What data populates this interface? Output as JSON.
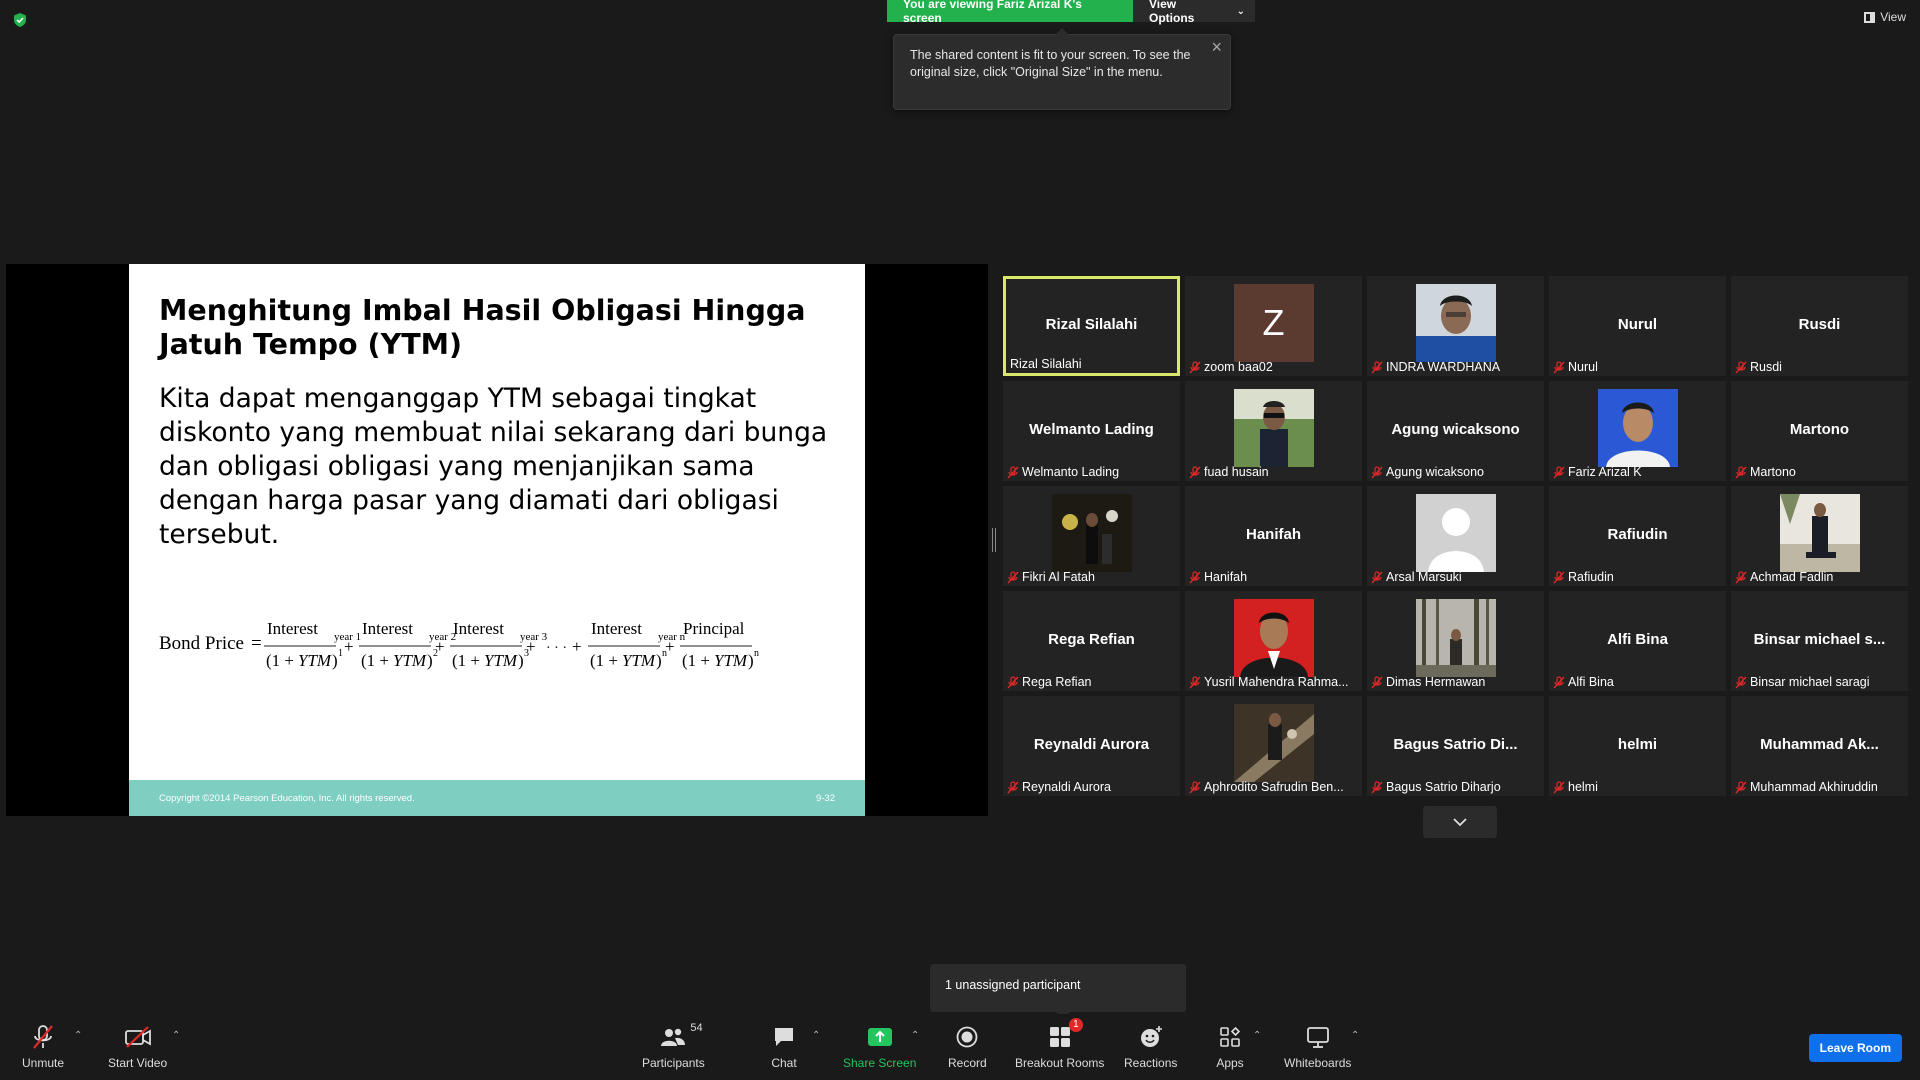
{
  "topbar": {
    "viewing_label": "You are viewing Fariz Arizal K's screen",
    "view_options_label": "View Options",
    "view_label": "View"
  },
  "tooltip": {
    "text": "The shared content is fit to your screen. To see the original size, click \"Original Size\" in the menu."
  },
  "slide": {
    "title": "Menghitung Imbal Hasil Obligasi Hingga Jatuh Tempo (YTM)",
    "body": "Kita dapat menganggap YTM sebagai tingkat diskonto yang membuat nilai sekarang dari bunga dan obligasi obligasi yang menjanjikan sama dengan harga pasar yang diamati dari obligasi tersebut.",
    "formula": {
      "lhs": "Bond Price",
      "terms": [
        {
          "num": "Interest",
          "sub": "year 1",
          "den": "(1 + YTM)",
          "exp": "1"
        },
        {
          "num": "Interest",
          "sub": "year 2",
          "den": "(1 + YTM)",
          "exp": "2"
        },
        {
          "num": "Interest",
          "sub": "year 3",
          "den": "(1 + YTM)",
          "exp": "3"
        },
        {
          "num": "Interest",
          "sub": "year n",
          "den": "(1 + YTM)",
          "exp": "n"
        },
        {
          "num": "Principal",
          "sub": "",
          "den": "(1 + YTM)",
          "exp": "n"
        }
      ],
      "ellipsis": "· · ·"
    },
    "footer_copyright": "Copyright ©2014 Pearson Education, Inc. All rights reserved.",
    "footer_page": "9-32"
  },
  "participants": [
    {
      "name": "Rizal Silalahi",
      "big": "Rizal Silalahi",
      "type": "name",
      "active": true,
      "muted": false
    },
    {
      "name": "zoom baa02",
      "big": "",
      "type": "letter",
      "letter": "Z",
      "muted": true
    },
    {
      "name": "INDRA WARDHANA",
      "big": "",
      "type": "photo",
      "photo": "portrait-blue",
      "muted": true
    },
    {
      "name": "Nurul",
      "big": "Nurul",
      "type": "name",
      "muted": true
    },
    {
      "name": "Rusdi",
      "big": "Rusdi",
      "type": "name",
      "muted": true
    },
    {
      "name": "Welmanto Lading",
      "big": "Welmanto Lading",
      "type": "name",
      "muted": true
    },
    {
      "name": "fuad husain",
      "big": "",
      "type": "photo",
      "photo": "outdoor-green",
      "muted": true
    },
    {
      "name": "Agung wicaksono",
      "big": "Agung wicaksono",
      "type": "name",
      "muted": true
    },
    {
      "name": "Fariz Arizal K",
      "big": "",
      "type": "photo",
      "photo": "portrait-bluebg",
      "muted": true
    },
    {
      "name": "Martono",
      "big": "Martono",
      "type": "name",
      "muted": true
    },
    {
      "name": "Fikri Al Fatah",
      "big": "",
      "type": "photo",
      "photo": "dark-party",
      "muted": true
    },
    {
      "name": "Hanifah",
      "big": "Hanifah",
      "type": "name",
      "muted": true
    },
    {
      "name": "Arsal Marsuki",
      "big": "",
      "type": "photo",
      "photo": "default-silhouette",
      "muted": true
    },
    {
      "name": "Rafiudin",
      "big": "Rafiudin",
      "type": "name",
      "muted": true
    },
    {
      "name": "Achmad Fadlin",
      "big": "",
      "type": "photo",
      "photo": "suit-outdoor",
      "muted": true
    },
    {
      "name": "Rega Refian",
      "big": "Rega Refian",
      "type": "name",
      "muted": true
    },
    {
      "name": "Yusril Mahendra Rahma...",
      "big": "",
      "type": "photo",
      "photo": "portrait-redbg",
      "muted": true
    },
    {
      "name": "Dimas Hermawan",
      "big": "",
      "type": "photo",
      "photo": "forest",
      "muted": true
    },
    {
      "name": "Alfi Bina",
      "big": "Alfi Bina",
      "type": "name",
      "muted": true
    },
    {
      "name": "Binsar michael saragi",
      "big": "Binsar michael s...",
      "type": "name",
      "muted": true
    },
    {
      "name": "Reynaldi Aurora",
      "big": "Reynaldi Aurora",
      "type": "name",
      "muted": true
    },
    {
      "name": "Aphrodito Safrudin Ben...",
      "big": "",
      "type": "photo",
      "photo": "escalator",
      "muted": true
    },
    {
      "name": "Bagus Satrio Diharjo",
      "big": "Bagus Satrio Di...",
      "type": "name",
      "muted": true
    },
    {
      "name": "helmi",
      "big": "helmi",
      "type": "name",
      "muted": true
    },
    {
      "name": "Muhammad Akhiruddin",
      "big": "Muhammad Ak...",
      "type": "name",
      "muted": true
    }
  ],
  "unassigned": {
    "text": "1 unassigned participant"
  },
  "toolbar": {
    "unmute": "Unmute",
    "start_video": "Start Video",
    "participants": "Participants",
    "participants_count": "54",
    "chat": "Chat",
    "share_screen": "Share Screen",
    "record": "Record",
    "breakout_rooms": "Breakout Rooms",
    "breakout_badge": "1",
    "reactions": "Reactions",
    "apps": "Apps",
    "whiteboards": "Whiteboards",
    "leave_room": "Leave Room"
  },
  "colors": {
    "share_green": "#22b14c",
    "active_border": "#d9e86b",
    "leave_blue": "#0e71eb",
    "footer_teal": "#7ecec2",
    "mute_red": "#e02828"
  }
}
